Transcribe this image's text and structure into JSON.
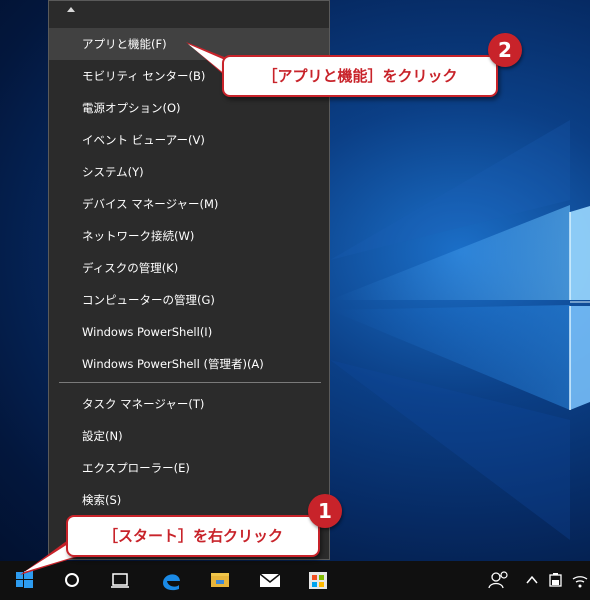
{
  "context_menu": {
    "items": [
      {
        "label": "アプリと機能(F)"
      },
      {
        "label": "モビリティ センター(B)"
      },
      {
        "label": "電源オプション(O)"
      },
      {
        "label": "イベント ビューアー(V)"
      },
      {
        "label": "システム(Y)"
      },
      {
        "label": "デバイス マネージャー(M)"
      },
      {
        "label": "ネットワーク接続(W)"
      },
      {
        "label": "ディスクの管理(K)"
      },
      {
        "label": "コンピューターの管理(G)"
      },
      {
        "label": "Windows PowerShell(I)"
      },
      {
        "label": "Windows PowerShell (管理者)(A)"
      },
      {
        "label": "タスク マネージャー(T)"
      },
      {
        "label": "設定(N)"
      },
      {
        "label": "エクスプローラー(E)"
      },
      {
        "label": "検索(S)"
      }
    ]
  },
  "callouts": {
    "step2": {
      "number": "2",
      "text": "［アプリと機能］をクリック"
    },
    "step1": {
      "number": "1",
      "text": "［スタート］を右クリック"
    }
  },
  "colors": {
    "callout_red": "#c8232a",
    "menu_bg": "#2b2b2b",
    "taskbar_bg": "#101010"
  },
  "taskbar": {
    "icons": [
      "start-icon",
      "cortana-icon",
      "task-view-icon",
      "edge-icon",
      "file-explorer-icon",
      "mail-icon",
      "store-icon",
      "people-icon",
      "chevron-up-icon",
      "battery-icon",
      "wifi-icon"
    ]
  }
}
